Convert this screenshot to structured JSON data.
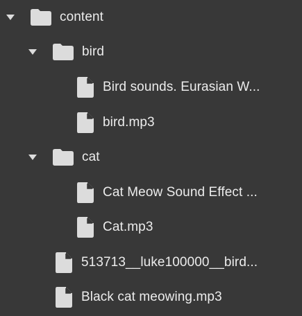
{
  "tree": {
    "content": {
      "label": "content",
      "icon": "folder-icon",
      "expanded": true
    },
    "bird_folder": {
      "label": "bird",
      "icon": "folder-icon",
      "expanded": true
    },
    "bird_file_1": {
      "label": "Bird sounds. Eurasian W...",
      "icon": "file-icon"
    },
    "bird_file_2": {
      "label": "bird.mp3",
      "icon": "file-icon"
    },
    "cat_folder": {
      "label": "cat",
      "icon": "folder-icon",
      "expanded": true
    },
    "cat_file_1": {
      "label": "Cat Meow Sound Effect ...",
      "icon": "file-icon"
    },
    "cat_file_2": {
      "label": "Cat.mp3",
      "icon": "file-icon"
    },
    "root_file_1": {
      "label": "513713__luke100000__bird...",
      "icon": "file-icon"
    },
    "root_file_2": {
      "label": "Black cat meowing.mp3",
      "icon": "file-icon"
    }
  },
  "colors": {
    "background": "#383838",
    "icon": "#dcdcdc",
    "text": "#ececec"
  }
}
